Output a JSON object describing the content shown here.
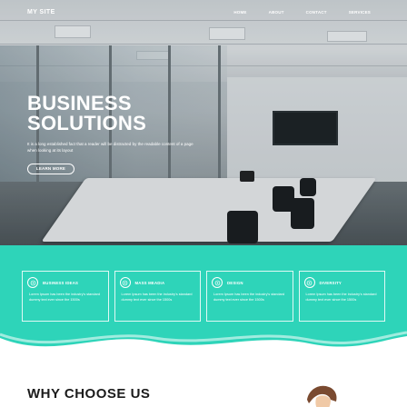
{
  "nav": {
    "brand": "MY SITE",
    "links": [
      "HOME",
      "ABOUT",
      "CONTACT",
      "SERVICES"
    ]
  },
  "hero": {
    "title_line1": "BUSINESS",
    "title_line2": "SOLUTIONS",
    "text": "It is a long established fact that a reader will be distracted by the readable content of a page when looking at its layout",
    "button_label": "LEARN MORE"
  },
  "features": [
    {
      "title": "BUSINESS IDEAS",
      "text": "Lorem Ipsum has been the industry's standard dummy text ever since the 1500s",
      "icon": "target-icon"
    },
    {
      "title": "MASS MEADIA",
      "text": "Lorem Ipsum has been the industry's standard dummy text ever since the 1500s",
      "icon": "target-icon"
    },
    {
      "title": "DESIGN",
      "text": "Lorem Ipsum has been the industry's standard dummy text ever since the 1500s",
      "icon": "target-icon"
    },
    {
      "title": "DIVERSITY",
      "text": "Lorem Ipsum has been the industry's standard dummy text ever since the 1500s",
      "icon": "target-icon"
    }
  ],
  "why": {
    "title": "WHY CHOOSE US"
  },
  "colors": {
    "teal": "#2ed4b9",
    "white": "#ffffff",
    "heading": "#1b1b1b"
  }
}
